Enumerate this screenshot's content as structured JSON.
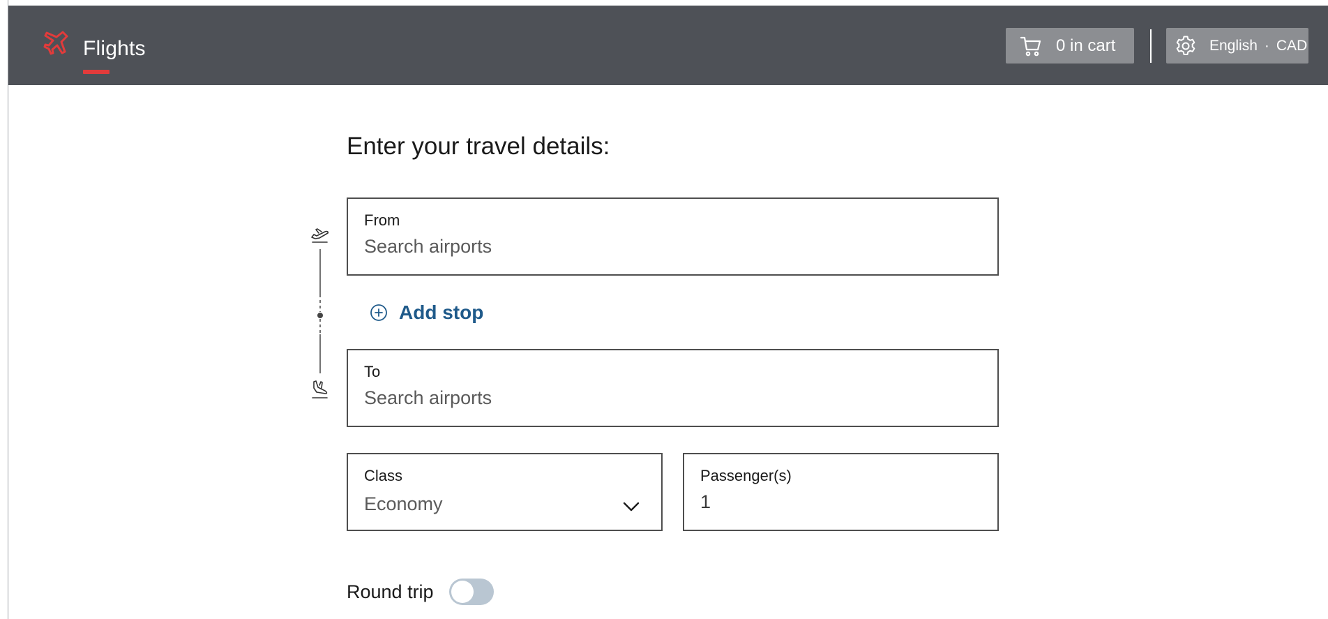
{
  "header": {
    "title": "Flights",
    "brand_icon": "plane-icon",
    "cart": {
      "label": "0 in cart",
      "icon": "cart-icon"
    },
    "locale": {
      "language": "English",
      "separator": "·",
      "currency": "CAD",
      "icon": "gear-icon"
    }
  },
  "form": {
    "heading": "Enter your travel details:",
    "from": {
      "label": "From",
      "placeholder": "Search airports"
    },
    "add_stop": {
      "label": "Add stop",
      "icon": "plus-circle-icon"
    },
    "to": {
      "label": "To",
      "placeholder": "Search airports"
    },
    "class": {
      "label": "Class",
      "value": "Economy",
      "icon": "chevron-down-icon"
    },
    "passengers": {
      "label": "Passenger(s)",
      "value": "1"
    },
    "round_trip": {
      "label": "Round trip",
      "enabled": false
    }
  },
  "colors": {
    "topbar": "#4e5157",
    "accent_red": "#e23b3b",
    "link_blue": "#1f5a8a",
    "button_grey": "#8c8e92",
    "toggle_off": "#b9c6d2"
  }
}
